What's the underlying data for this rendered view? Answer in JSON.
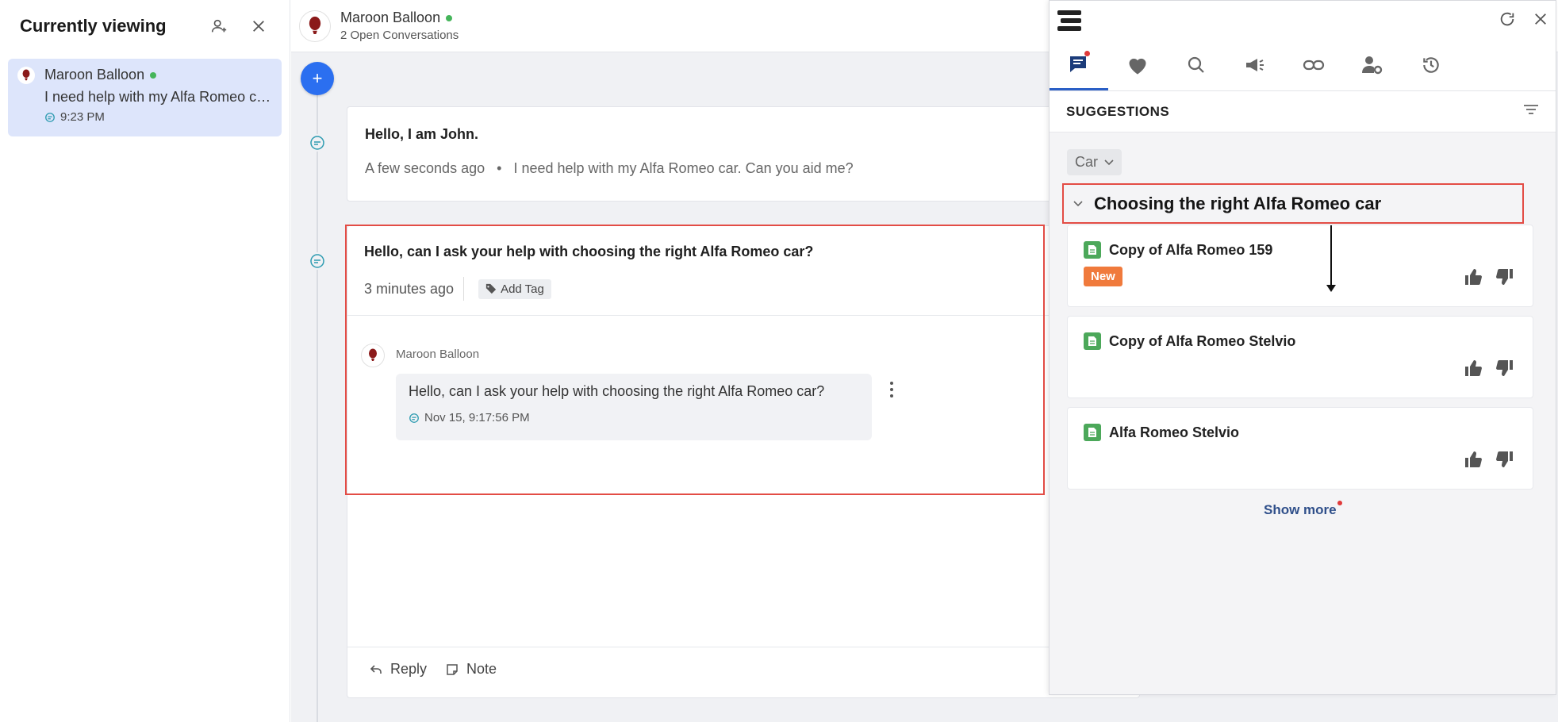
{
  "sidebar": {
    "title": "Currently viewing",
    "visitor": {
      "name": "Maroon Balloon",
      "message": "I need help with my Alfa Romeo car. Can you aid me?",
      "time": "9:23 PM"
    }
  },
  "conversation": {
    "name": "Maroon Balloon",
    "subtitle": "2 Open Conversations",
    "card1": {
      "title": "Hello, I am John.",
      "time": "A few seconds ago",
      "message": "I need help with my Alfa Romeo car. Can you aid me?"
    },
    "card2": {
      "title": "Hello, can I ask your help with choosing the right Alfa Romeo car?",
      "time": "3 minutes ago",
      "tag_label": "Add Tag",
      "author": "Maroon Balloon",
      "message": "Hello, can I ask your help with choosing the right Alfa Romeo car?",
      "message_time": "Nov 15, 9:17:56 PM",
      "reply_label": "Reply",
      "note_label": "Note"
    }
  },
  "panel": {
    "section_title": "SUGGESTIONS",
    "filter": "Car",
    "category": "Choosing the right Alfa Romeo car",
    "suggestions": [
      {
        "title": "Copy of Alfa Romeo 159",
        "badge": "New"
      },
      {
        "title": "Copy of Alfa Romeo Stelvio",
        "badge": ""
      },
      {
        "title": "Alfa Romeo Stelvio",
        "badge": ""
      }
    ],
    "show_more": "Show more",
    "tabs": [
      "chat-icon",
      "heart-icon",
      "search-icon",
      "megaphone-icon",
      "link-icon",
      "user-settings-icon",
      "history-icon"
    ]
  },
  "colors": {
    "accent": "#2b6ff0",
    "highlight": "#e34c45",
    "online": "#45b55a",
    "badge_new": "#f07a3c",
    "doc_green": "#4ca85a"
  }
}
